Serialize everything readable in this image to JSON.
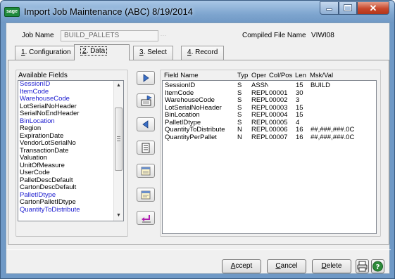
{
  "window": {
    "title": "Import Job Maintenance (ABC) 8/19/2014",
    "logo": "sage",
    "controls": [
      "minimize-icon",
      "maximize-icon",
      "close-icon"
    ]
  },
  "header": {
    "job_name_label": "Job Name",
    "job_name_value": "BUILD_PALLETS",
    "compiled_label": "Compiled File Name",
    "compiled_value": "VIWI08"
  },
  "tabs": [
    {
      "num": "1",
      "rest": ". Configuration"
    },
    {
      "num": "2",
      "rest": ". Data"
    },
    {
      "num": "3",
      "rest": ". Select"
    },
    {
      "num": "4",
      "rest": ". Record"
    }
  ],
  "active_tab": 1,
  "available_fields": {
    "label": "Available Fields",
    "items": [
      {
        "text": "SessionID",
        "linked": true
      },
      {
        "text": "ItemCode",
        "linked": true
      },
      {
        "text": "WarehouseCode",
        "linked": true
      },
      {
        "text": "LotSerialNoHeader",
        "linked": false
      },
      {
        "text": "SerialNoEndHeader",
        "linked": false
      },
      {
        "text": "BinLocation",
        "linked": true
      },
      {
        "text": "Region",
        "linked": false
      },
      {
        "text": "ExpirationDate",
        "linked": false
      },
      {
        "text": "VendorLotSerialNo",
        "linked": false
      },
      {
        "text": "TransactionDate",
        "linked": false
      },
      {
        "text": "Valuation",
        "linked": false
      },
      {
        "text": "UnitOfMeasure",
        "linked": false
      },
      {
        "text": "UserCode",
        "linked": false
      },
      {
        "text": "PalletDescDefault",
        "linked": false
      },
      {
        "text": "CartonDescDefault",
        "linked": false
      },
      {
        "text": "PalletIDtype",
        "linked": true
      },
      {
        "text": "CartonPalletIDtype",
        "linked": false
      },
      {
        "text": "QuantityToDistribute",
        "linked": true
      }
    ]
  },
  "side_buttons": [
    "move-right-icon",
    "insert-field-icon",
    "move-left-icon",
    "field-list-icon",
    "edit-field-icon",
    "field-properties-icon",
    "undo-return-icon"
  ],
  "selected_fields": {
    "columns": [
      "Field Name",
      "Typ",
      "Oper",
      "Col/Pos",
      "Len",
      "Msk/Val"
    ],
    "rows": [
      [
        "SessionID",
        "S",
        "ASSN",
        "",
        "15",
        "BUILD"
      ],
      [
        "ItemCode",
        "S",
        "REPL",
        "00001",
        "30",
        ""
      ],
      [
        "WarehouseCode",
        "S",
        "REPL",
        "00002",
        "3",
        ""
      ],
      [
        "LotSerialNoHeader",
        "S",
        "REPL",
        "00003",
        "15",
        ""
      ],
      [
        "BinLocation",
        "S",
        "REPL",
        "00004",
        "15",
        ""
      ],
      [
        "PalletIDtype",
        "S",
        "REPL",
        "00005",
        "4",
        ""
      ],
      [
        "QuantityToDistribute",
        "N",
        "REPL",
        "00006",
        "16",
        "##,###,###.0C"
      ],
      [
        "QuantityPerPallet",
        "N",
        "REPL",
        "00007",
        "16",
        "##,###,###.0C"
      ]
    ]
  },
  "buttons": {
    "accept_ul": "A",
    "accept_rest": "ccept",
    "cancel_ul": "C",
    "cancel_rest": "ancel",
    "delete_ul": "D",
    "delete_rest": "elete"
  },
  "footer_icons": [
    "printer-icon",
    "help-icon"
  ],
  "colors": {
    "linked_field": "#2020d0",
    "accent_title": "#7ea5cf",
    "help_green": "#2e8b3a"
  }
}
